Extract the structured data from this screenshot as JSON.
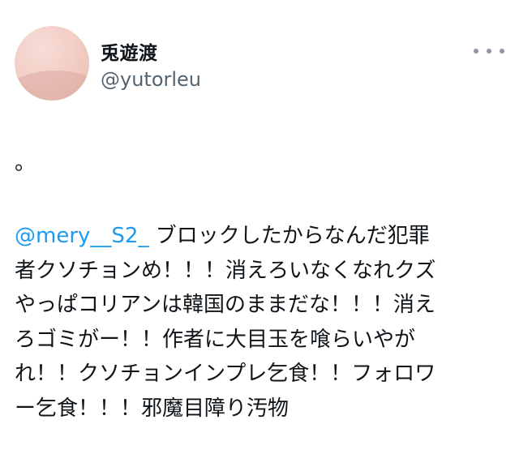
{
  "user": {
    "display_name": "兎遊渡",
    "handle": "@yutorleu"
  },
  "tweet": {
    "first_line": "。",
    "mention": "@mery__S2_",
    "lines": [
      " ブロックしたからなんだ犯罪",
      "者クソチョンめ！！！消えろいなくなれクズ",
      "やっぱコリアンは韓国のままだな！！！消え",
      "ろゴミがー！！作者に大目玉を喰らいやが",
      "れ！！クソチョンインプレ乞食！！フォロワ",
      "ー乞食！！！邪魔目障り汚物"
    ]
  },
  "icons": {
    "more": "more-horizontal-icon"
  },
  "colors": {
    "mention": "#1d9bf0",
    "handle": "#536471",
    "text": "#0f1419"
  }
}
